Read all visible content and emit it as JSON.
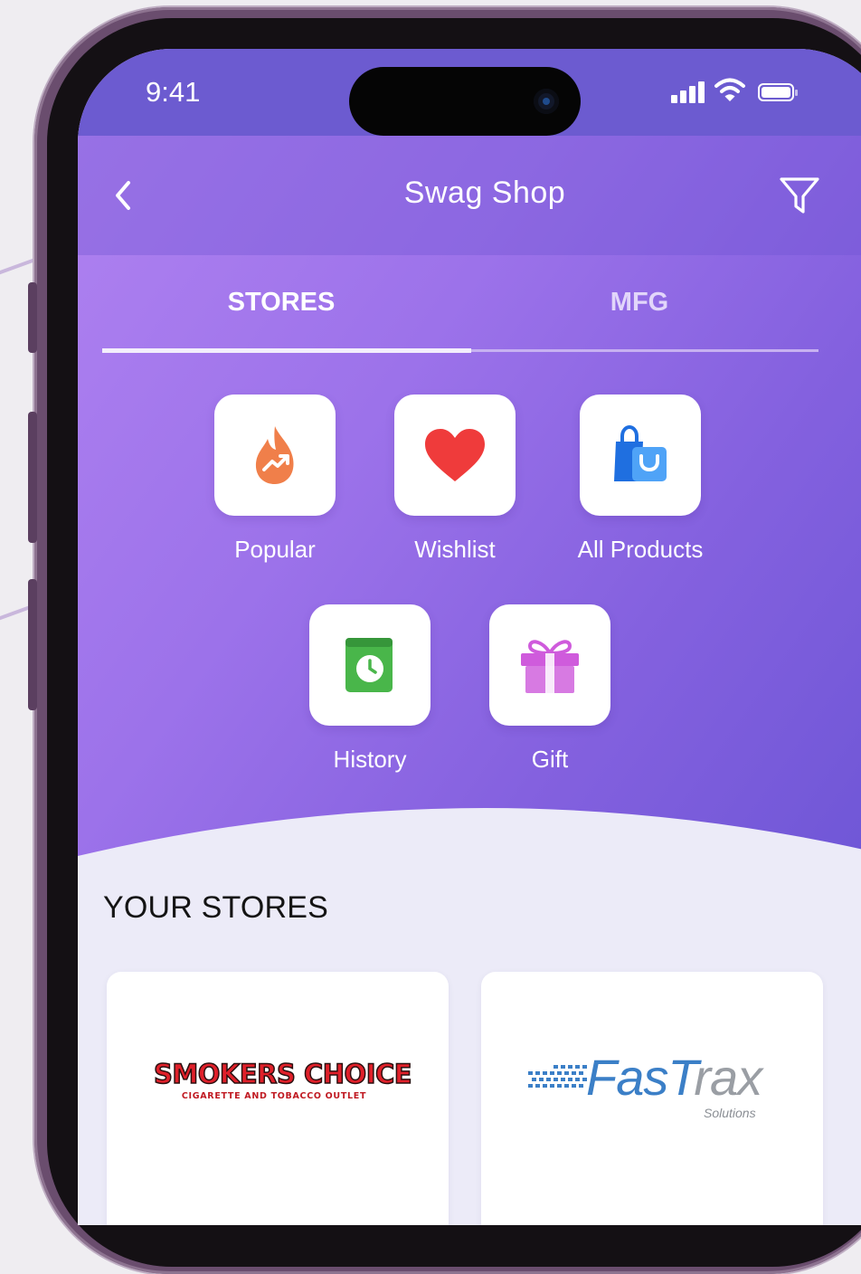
{
  "status_bar": {
    "time": "9:41"
  },
  "nav": {
    "title": "Swag Shop",
    "back_icon": "chevron-left-icon",
    "filter_icon": "filter-icon"
  },
  "tabs": [
    {
      "label": "STORES",
      "active": true
    },
    {
      "label": "MFG",
      "active": false
    }
  ],
  "categories": [
    {
      "label": "Popular",
      "icon": "flame-trending-icon",
      "color": "#f07f4a"
    },
    {
      "label": "Wishlist",
      "icon": "heart-icon",
      "color": "#ef3b3b"
    },
    {
      "label": "All Products",
      "icon": "shopping-bags-icon",
      "color": "#2f86f2"
    },
    {
      "label": "History",
      "icon": "clock-book-icon",
      "color": "#49b64a"
    },
    {
      "label": "Gift",
      "icon": "gift-icon",
      "color": "#cf5bdc"
    }
  ],
  "section": {
    "title": "YOUR STORES"
  },
  "stores": [
    {
      "name": "SMOKERS CHOICE",
      "tagline": "CIGARETTE AND TOBACCO OUTLET"
    },
    {
      "name_a": "FasT",
      "name_b": "rax",
      "tagline": "Solutions"
    }
  ],
  "theme": {
    "accent": "#8a66e4",
    "header": "#6c5bd0",
    "surface": "#ecebf8"
  }
}
